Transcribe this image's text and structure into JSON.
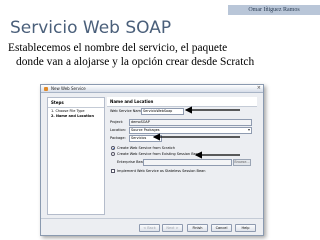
{
  "author_banner": "Omar Iñiguez Ramos",
  "slide": {
    "title": "Servicio Web SOAP",
    "body_line1": "Establecemos el nombre del servicio, el paquete",
    "body_line2": "donde van a alojarse y la opción crear desde Scratch"
  },
  "dialog": {
    "window_title": "New Web Service",
    "close_glyph": "×",
    "steps_heading": "Steps",
    "steps": [
      {
        "num": "1.",
        "label": "Choose File Type"
      },
      {
        "num": "2.",
        "label": "Name and Location"
      }
    ],
    "panel_heading": "Name and Location",
    "fields": {
      "name_label": "Web Service Name:",
      "name_value": "ServicioWebSoap",
      "project_label": "Project:",
      "project_value": "demoSOAP",
      "location_label": "Location:",
      "location_value": "Source Packages",
      "package_label": "Package:",
      "package_value": "Servicios"
    },
    "options": {
      "scratch_label": "Create Web Service from Scratch",
      "scratch_selected": true,
      "session_bean_label": "Create Web Service from Existing Session Bean",
      "session_bean_selected": false,
      "enterprise_bean_label": "Enterprise Bean:",
      "enterprise_bean_value": "",
      "browse_label": "Browse...",
      "stateless_label": "Implement Web Service as Stateless Session Bean",
      "stateless_checked": false
    },
    "buttons": {
      "back": "< Back",
      "next": "Next >",
      "finish": "Finish",
      "cancel": "Cancel",
      "help": "Help"
    }
  },
  "colors": {
    "title_text": "#4a5f7a",
    "author_banner_bg": "#b9c6d8",
    "annotation_arrow": "#000000"
  }
}
